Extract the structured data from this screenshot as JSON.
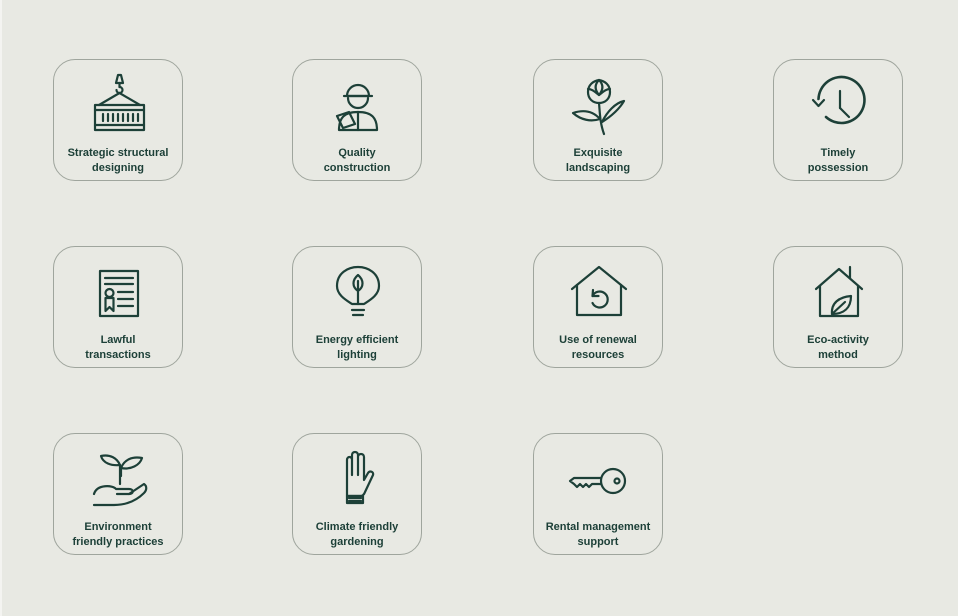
{
  "cards": [
    {
      "icon": "crane-container-icon",
      "line1": "Strategic structural",
      "line2": "designing"
    },
    {
      "icon": "construction-worker-icon",
      "line1": "Quality",
      "line2": "construction"
    },
    {
      "icon": "flower-icon",
      "line1": "Exquisite",
      "line2": "landscaping"
    },
    {
      "icon": "clock-icon",
      "line1": "Timely",
      "line2": "possession"
    },
    {
      "icon": "certificate-document-icon",
      "line1": "Lawful",
      "line2": "transactions"
    },
    {
      "icon": "eco-bulb-icon",
      "line1": "Energy efficient",
      "line2": "lighting"
    },
    {
      "icon": "house-renew-icon",
      "line1": "Use of renewal",
      "line2": "resources"
    },
    {
      "icon": "house-leaf-icon",
      "line1": "Eco-activity",
      "line2": "method"
    },
    {
      "icon": "hand-sprout-icon",
      "line1": "Environment",
      "line2": "friendly practices"
    },
    {
      "icon": "glove-icon",
      "line1": "Climate friendly",
      "line2": "gardening"
    },
    {
      "icon": "key-icon",
      "line1": "Rental management",
      "line2": "support"
    }
  ],
  "colors": {
    "background": "#e8e9e3",
    "accent": "#1d4038",
    "border": "#9fa59d"
  }
}
